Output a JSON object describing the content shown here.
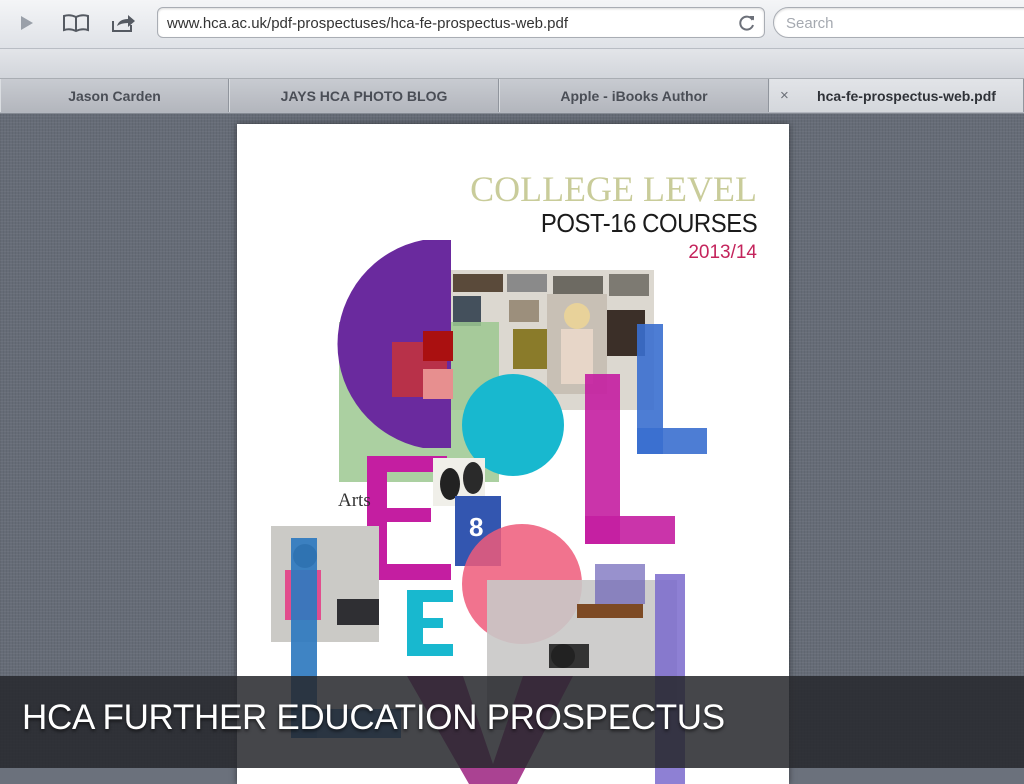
{
  "browser": {
    "url": "www.hca.ac.uk/pdf-prospectuses/hca-fe-prospectus-web.pdf",
    "search_placeholder": "Search",
    "tabs": [
      {
        "label": "Jason Carden",
        "active": false
      },
      {
        "label": "JAYS HCA PHOTO BLOG",
        "active": false
      },
      {
        "label": "Apple - iBooks Author",
        "active": false
      },
      {
        "label": "hca-fe-prospectus-web.pdf",
        "active": true
      }
    ],
    "close_glyph": "×"
  },
  "document": {
    "line1": "COLLEGE LEVEL",
    "line2": "POST-16 COURSES",
    "line3": "2013/14",
    "arts_label": "Arts",
    "colors": {
      "purple": "#6a2a9e",
      "magenta": "#c41ea1",
      "cyan": "#18b8cf",
      "blue": "#3a6fcf",
      "pink": "#ee5a7a",
      "green": "#9cc890",
      "heading_gold": "#c9cc9a",
      "heading_red": "#c4245c"
    }
  },
  "caption": {
    "text": "HCA FURTHER EDUCATION PROSPECTUS"
  },
  "icons": [
    "play-icon",
    "bookmarks-icon",
    "share-icon",
    "reload-icon",
    "close-icon"
  ]
}
